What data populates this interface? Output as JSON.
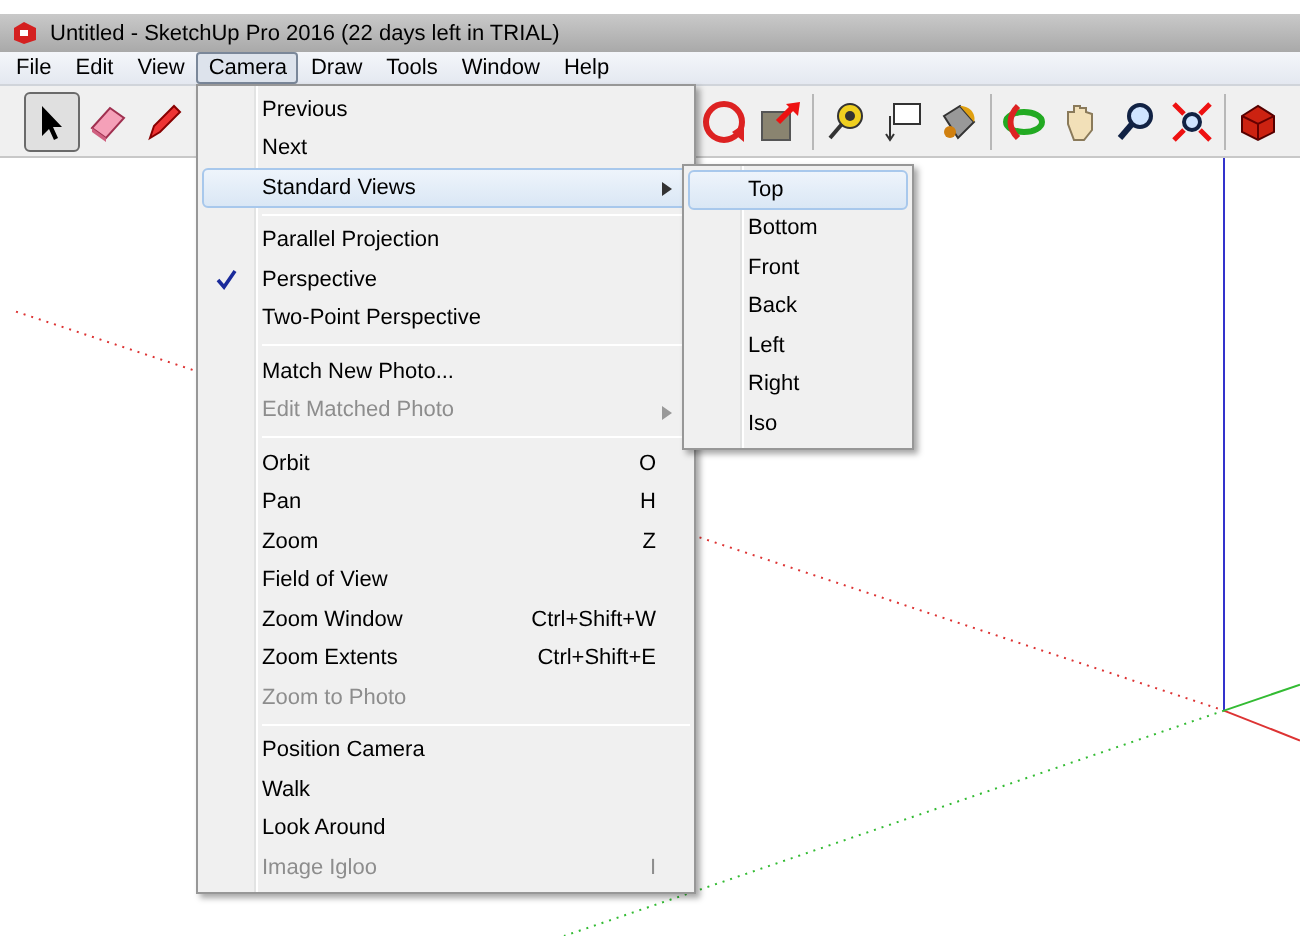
{
  "window": {
    "title": "Untitled - SketchUp Pro 2016 (22 days left in TRIAL)"
  },
  "menubar": [
    {
      "label": "File",
      "selected": false
    },
    {
      "label": "Edit",
      "selected": false
    },
    {
      "label": "View",
      "selected": false
    },
    {
      "label": "Camera",
      "selected": true
    },
    {
      "label": "Draw",
      "selected": false
    },
    {
      "label": "Tools",
      "selected": false
    },
    {
      "label": "Window",
      "selected": false
    },
    {
      "label": "Help",
      "selected": false
    }
  ],
  "toolbar": [
    {
      "kind": "select",
      "pressed": true
    },
    {
      "kind": "eraser",
      "pressed": false
    },
    {
      "kind": "pencil",
      "pressed": false
    },
    {
      "kind": "gap"
    },
    {
      "kind": "rotate",
      "pressed": false
    },
    {
      "kind": "pushpull",
      "pressed": false
    },
    {
      "kind": "sep"
    },
    {
      "kind": "tape",
      "pressed": false
    },
    {
      "kind": "label",
      "pressed": false
    },
    {
      "kind": "bucket",
      "pressed": false
    },
    {
      "kind": "sep"
    },
    {
      "kind": "orbit",
      "pressed": false
    },
    {
      "kind": "pan",
      "pressed": false
    },
    {
      "kind": "zoom",
      "pressed": false
    },
    {
      "kind": "extents",
      "pressed": false
    },
    {
      "kind": "sep"
    },
    {
      "kind": "warehouse",
      "pressed": false
    }
  ],
  "camera_menu": [
    {
      "kind": "item",
      "label": "Previous",
      "disabled": false,
      "checked": false,
      "selected": false
    },
    {
      "kind": "item",
      "label": "Next",
      "disabled": false,
      "checked": false,
      "selected": false
    },
    {
      "kind": "item",
      "label": "Standard Views",
      "disabled": false,
      "checked": false,
      "selected": true,
      "submenu": true
    },
    {
      "kind": "separator"
    },
    {
      "kind": "item",
      "label": "Parallel Projection",
      "disabled": false,
      "checked": false,
      "selected": false
    },
    {
      "kind": "item",
      "label": "Perspective",
      "disabled": false,
      "checked": true,
      "selected": false
    },
    {
      "kind": "item",
      "label": "Two-Point Perspective",
      "disabled": false,
      "checked": false,
      "selected": false
    },
    {
      "kind": "separator"
    },
    {
      "kind": "item",
      "label": "Match New Photo...",
      "disabled": false,
      "checked": false,
      "selected": false
    },
    {
      "kind": "item",
      "label": "Edit Matched Photo",
      "disabled": true,
      "checked": false,
      "selected": false,
      "submenu": true
    },
    {
      "kind": "separator"
    },
    {
      "kind": "item",
      "label": "Orbit",
      "shortcut": "O",
      "disabled": false,
      "checked": false,
      "selected": false
    },
    {
      "kind": "item",
      "label": "Pan",
      "shortcut": "H",
      "disabled": false,
      "checked": false,
      "selected": false
    },
    {
      "kind": "item",
      "label": "Zoom",
      "shortcut": "Z",
      "disabled": false,
      "checked": false,
      "selected": false
    },
    {
      "kind": "item",
      "label": "Field of View",
      "disabled": false,
      "checked": false,
      "selected": false
    },
    {
      "kind": "item",
      "label": "Zoom Window",
      "shortcut": "Ctrl+Shift+W",
      "disabled": false,
      "checked": false,
      "selected": false
    },
    {
      "kind": "item",
      "label": "Zoom Extents",
      "shortcut": "Ctrl+Shift+E",
      "disabled": false,
      "checked": false,
      "selected": false
    },
    {
      "kind": "item",
      "label": "Zoom to Photo",
      "disabled": true,
      "checked": false,
      "selected": false
    },
    {
      "kind": "separator"
    },
    {
      "kind": "item",
      "label": "Position Camera",
      "disabled": false,
      "checked": false,
      "selected": false
    },
    {
      "kind": "item",
      "label": "Walk",
      "disabled": false,
      "checked": false,
      "selected": false
    },
    {
      "kind": "item",
      "label": "Look Around",
      "disabled": false,
      "checked": false,
      "selected": false
    },
    {
      "kind": "item",
      "label": "Image Igloo",
      "shortcut": "I",
      "disabled": true,
      "checked": false,
      "selected": false
    }
  ],
  "standard_views_menu": [
    {
      "label": "Top",
      "selected": true
    },
    {
      "label": "Bottom",
      "selected": false
    },
    {
      "label": "Front",
      "selected": false
    },
    {
      "label": "Back",
      "selected": false
    },
    {
      "label": "Left",
      "selected": false
    },
    {
      "label": "Right",
      "selected": false
    },
    {
      "label": "Iso",
      "selected": false
    }
  ]
}
